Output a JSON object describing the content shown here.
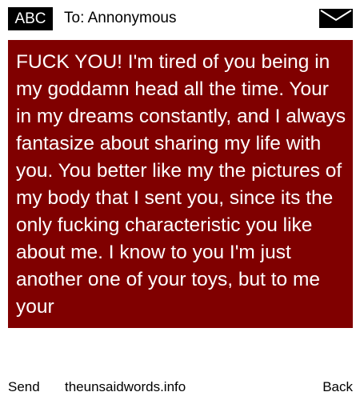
{
  "header": {
    "badge_label": "ABC",
    "recipient_text": "To: Annonymous",
    "envelope_icon": "envelope-icon"
  },
  "message": {
    "body": "FUCK YOU! I'm tired of you being in my goddamn head all the time. Your in my dreams constantly, and I always fantasize about sharing my life with you. You better like my the pictures of my body that I sent you, since its the only fucking characteristic you like about me. I know to you I'm just another one of your toys, but to me your"
  },
  "footer": {
    "send_label": "Send",
    "site_label": "theunsaidwords.info",
    "back_label": "Back"
  },
  "colors": {
    "background": "#ffffff",
    "message_background": "#800000",
    "message_text": "#ffffff",
    "badge_background": "#000000",
    "badge_text": "#ffffff"
  }
}
